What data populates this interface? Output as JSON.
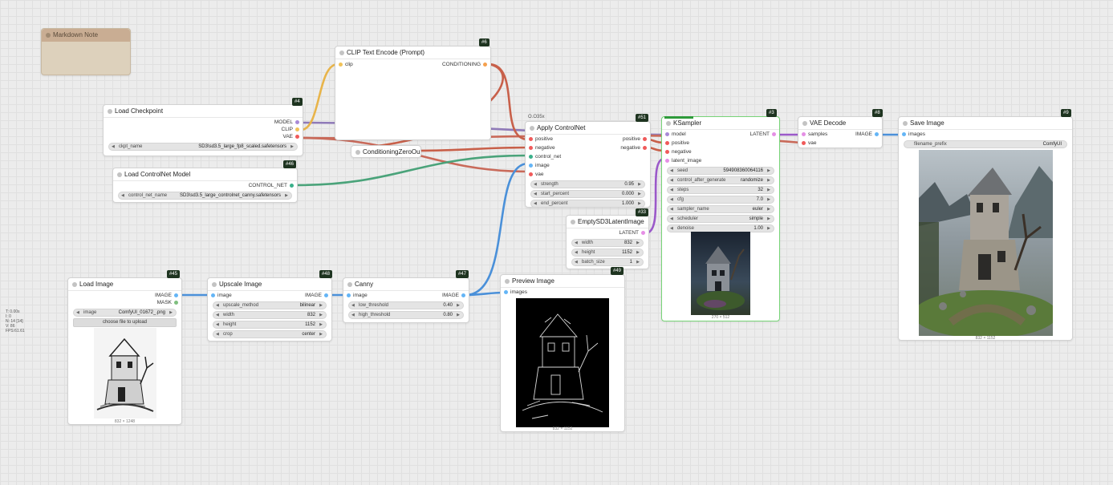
{
  "colors": {
    "model": "#a88ad6",
    "clip": "#f1c258",
    "vae": "#f05a5a",
    "conditioning": "#f5a04e",
    "control_net": "#3ab08a",
    "image": "#64b5f6",
    "mask": "#7fbf7f",
    "latent": "#e58fe5"
  },
  "stats": {
    "line1": "T: 0.00s",
    "line2": "I: 0",
    "line3": "N: 14 [14]",
    "line4": "V: 86",
    "line5": "FPS:61.61"
  },
  "group_tag": "O.O35x",
  "nodes": {
    "markdown_note": {
      "title": "Markdown Note"
    },
    "clip_text_encode": {
      "badge": "#6",
      "title": "CLIP Text Encode (Prompt)",
      "input_clip": "clip",
      "output_conditioning": "CONDITIONING"
    },
    "load_checkpoint": {
      "badge": "#4",
      "title": "Load Checkpoint",
      "out_model": "MODEL",
      "out_clip": "CLIP",
      "out_vae": "VAE",
      "w_ckpt_name": "ckpt_name",
      "w_ckpt_value": "SD3\\sd3.5_large_fp8_scaled.safetensors"
    },
    "conditioning_zero_out": {
      "title": "ConditioningZeroOut"
    },
    "load_controlnet": {
      "badge": "#46",
      "title": "Load ControlNet Model",
      "out_control_net": "CONTROL_NET",
      "w_name": "control_net_name",
      "w_value": "SD3\\sd3.5_large_controlnet_canny.safetensors"
    },
    "apply_controlnet": {
      "badge": "#51",
      "title": "Apply ControlNet",
      "in_positive": "positive",
      "in_negative": "negative",
      "in_control_net": "control_net",
      "in_image": "image",
      "in_vae": "vae",
      "out_positive": "positive",
      "out_negative": "negative",
      "w_strength": "strength",
      "v_strength": "0.95",
      "w_start": "start_percent",
      "v_start": "0.000",
      "w_end": "end_percent",
      "v_end": "1.000"
    },
    "empty_latent": {
      "badge": "#33",
      "title": "EmptySD3LatentImage",
      "out_latent": "LATENT",
      "w_width": "width",
      "v_width": "832",
      "w_height": "height",
      "v_height": "1152",
      "w_batch": "batch_size",
      "v_batch": "1"
    },
    "ksampler": {
      "badge": "#3",
      "title": "KSampler",
      "in_model": "model",
      "in_positive": "positive",
      "in_negative": "negative",
      "in_latent": "latent_image",
      "out_latent": "LATENT",
      "w_seed": "seed",
      "v_seed": "594908360064116",
      "w_control": "control_after_generate",
      "v_control": "randomize",
      "w_steps": "steps",
      "v_steps": "32",
      "w_cfg": "cfg",
      "v_cfg": "7.0",
      "w_sampler": "sampler_name",
      "v_sampler": "euler",
      "w_scheduler": "scheduler",
      "v_scheduler": "simple",
      "w_denoise": "denoise",
      "v_denoise": "1.00",
      "caption": "270 × 512"
    },
    "vae_decode": {
      "badge": "#8",
      "title": "VAE Decode",
      "in_samples": "samples",
      "in_vae": "vae",
      "out_image": "IMAGE"
    },
    "save_image": {
      "badge": "#9",
      "title": "Save Image",
      "in_images": "images",
      "w_prefix": "filename_prefix",
      "v_prefix": "ComfyUI",
      "caption": "832 × 1152"
    },
    "load_image": {
      "badge": "#45",
      "title": "Load Image",
      "out_image": "IMAGE",
      "out_mask": "MASK",
      "w_image": "image",
      "v_image": "ComfyUI_01672_.png",
      "upload": "choose file to upload",
      "caption": "832 × 1248"
    },
    "upscale_image": {
      "badge": "#48",
      "title": "Upscale Image",
      "in_image": "image",
      "out_image": "IMAGE",
      "w_method": "upscale_method",
      "v_method": "bilinear",
      "w_width": "width",
      "v_width": "832",
      "w_height": "height",
      "v_height": "1152",
      "w_crop": "crop",
      "v_crop": "center"
    },
    "canny": {
      "badge": "#47",
      "title": "Canny",
      "in_image": "image",
      "out_image": "IMAGE",
      "w_low": "low_threshold",
      "v_low": "0.40",
      "w_high": "high_threshold",
      "v_high": "0.80"
    },
    "preview_image": {
      "badge": "#49",
      "title": "Preview Image",
      "in_images": "images",
      "caption": "832 × 1152"
    }
  }
}
